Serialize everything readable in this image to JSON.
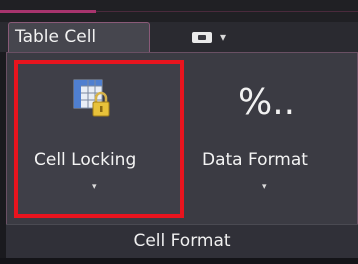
{
  "tabs": [
    {
      "label": "Table Cell",
      "active": true
    }
  ],
  "tab_dropdown": {
    "caret": "▾"
  },
  "panel": {
    "title": "Cell Format",
    "buttons": [
      {
        "label": "Cell Locking",
        "caret": "▾",
        "icon": "cell-lock-icon",
        "highlighted": true
      },
      {
        "label": "Data Format",
        "caret": "▾",
        "icon": "percent-icon",
        "glyph": "%.."
      }
    ]
  },
  "colors": {
    "highlight": "#e8141e",
    "accent": "#a8346e",
    "panel_bg": "#3b3b43",
    "text": "#f4f4f4"
  }
}
